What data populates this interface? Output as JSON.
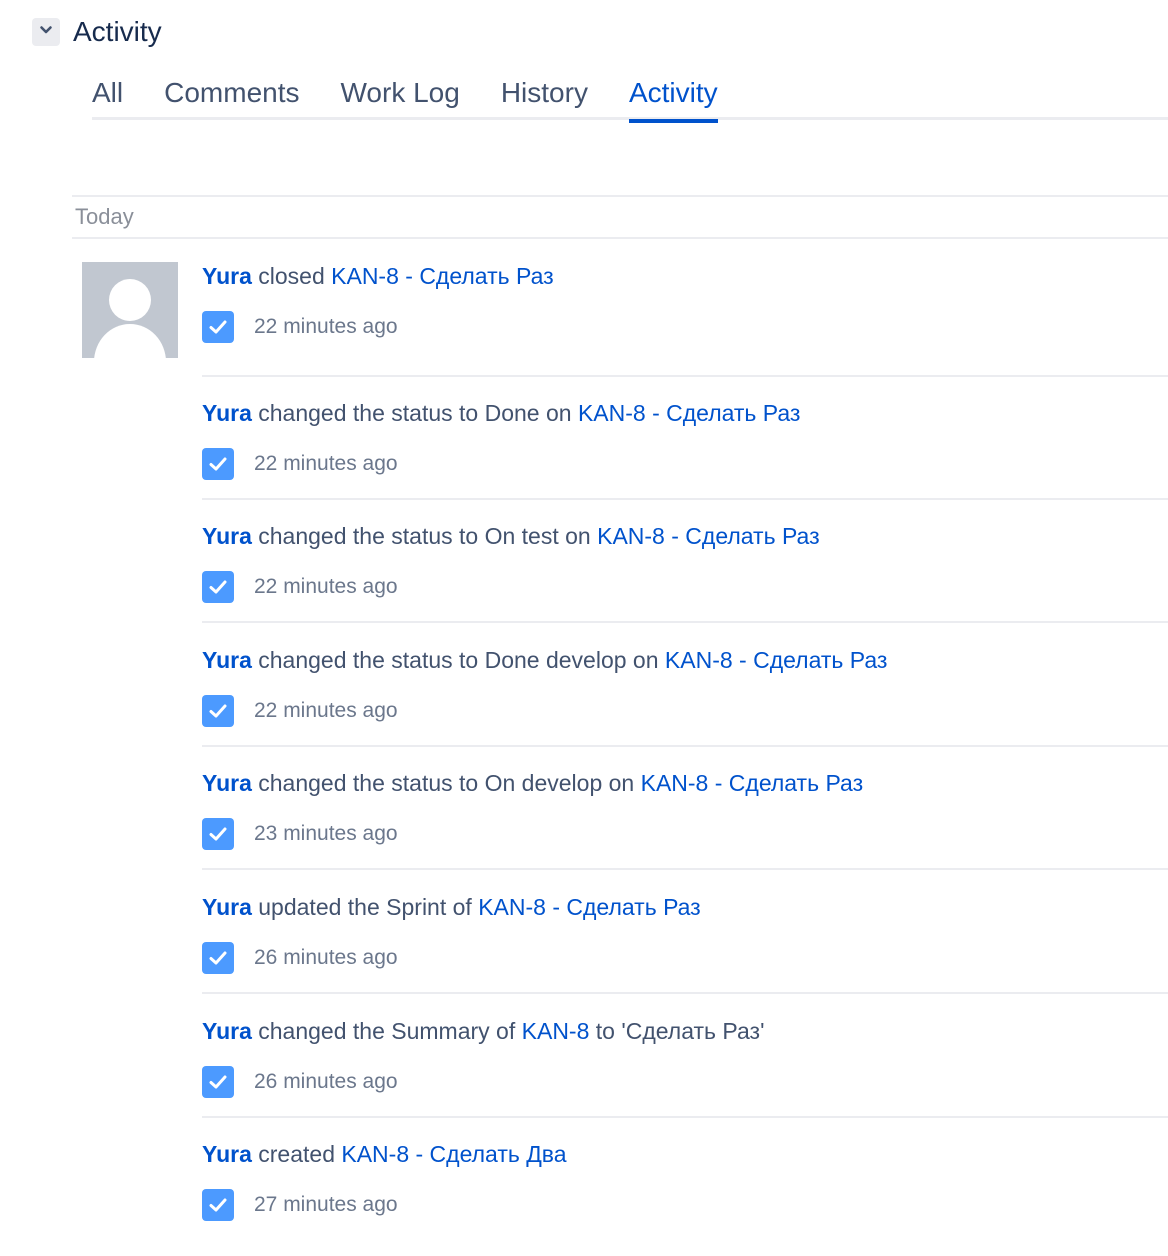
{
  "section": {
    "title": "Activity",
    "toggle_icon": "chevron-down-icon"
  },
  "tabs": [
    {
      "label": "All"
    },
    {
      "label": "Comments"
    },
    {
      "label": "Work Log"
    },
    {
      "label": "History"
    },
    {
      "label": "Activity",
      "active": true
    }
  ],
  "day_label": "Today",
  "colors": {
    "link": "#0052cc",
    "check": "#4c9aff"
  },
  "entries": [
    {
      "actor": "Yura",
      "action": "closed",
      "link": "KAN-8 - Сделать Раз",
      "suffix": "",
      "time": "22 minutes ago"
    },
    {
      "actor": "Yura",
      "action": "changed the status to Done on",
      "link": "KAN-8 - Сделать Раз",
      "suffix": "",
      "time": "22 minutes ago"
    },
    {
      "actor": "Yura",
      "action": "changed the status to On test on",
      "link": "KAN-8 - Сделать Раз",
      "suffix": "",
      "time": "22 minutes ago"
    },
    {
      "actor": "Yura",
      "action": "changed the status to Done develop on",
      "link": "KAN-8 - Сделать Раз",
      "suffix": "",
      "time": "22 minutes ago"
    },
    {
      "actor": "Yura",
      "action": "changed the status to On develop on",
      "link": "KAN-8 - Сделать Раз",
      "suffix": "",
      "time": "23 minutes ago"
    },
    {
      "actor": "Yura",
      "action": "updated the Sprint of",
      "link": "KAN-8 - Сделать Раз",
      "suffix": "",
      "time": "26 minutes ago"
    },
    {
      "actor": "Yura",
      "action": "changed the Summary of",
      "link": "KAN-8",
      "suffix": "to 'Сделать Раз'",
      "time": "26 minutes ago"
    },
    {
      "actor": "Yura",
      "action": "created",
      "link": "KAN-8 - Сделать Два",
      "suffix": "",
      "time": "27 minutes ago"
    }
  ]
}
